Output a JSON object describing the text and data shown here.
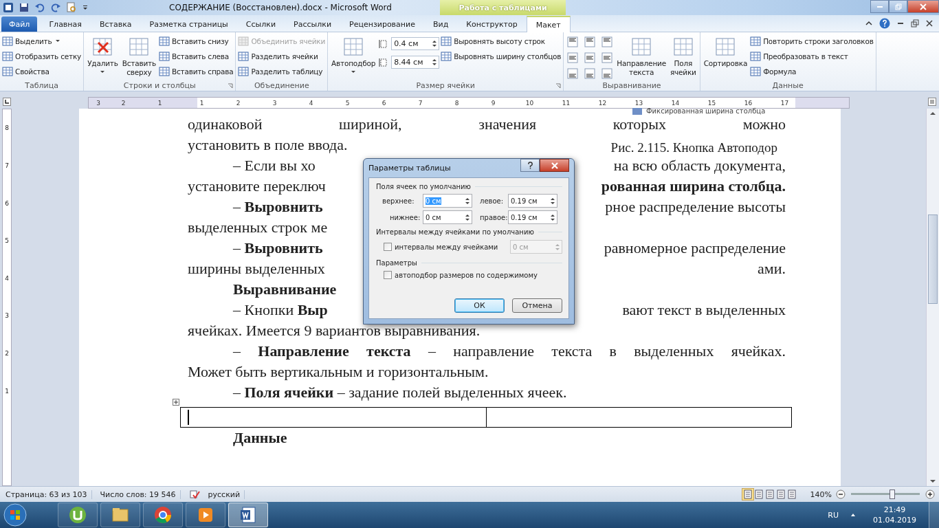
{
  "window": {
    "title": "СОДЕРЖАНИЕ (Восстановлен).docx - Microsoft Word",
    "context_group": "Работа с таблицами"
  },
  "tabs": [
    {
      "label": "Файл",
      "kind": "file",
      "selected": false
    },
    {
      "label": "Главная",
      "kind": "normal",
      "selected": false
    },
    {
      "label": "Вставка",
      "kind": "normal",
      "selected": false
    },
    {
      "label": "Разметка страницы",
      "kind": "normal",
      "selected": false
    },
    {
      "label": "Ссылки",
      "kind": "normal",
      "selected": false
    },
    {
      "label": "Рассылки",
      "kind": "normal",
      "selected": false
    },
    {
      "label": "Рецензирование",
      "kind": "normal",
      "selected": false
    },
    {
      "label": "Вид",
      "kind": "normal",
      "selected": false
    },
    {
      "label": "Конструктор",
      "kind": "context",
      "selected": false
    },
    {
      "label": "Макет",
      "kind": "context",
      "selected": true
    }
  ],
  "ribbon_groups": [
    {
      "label": "Таблица",
      "launcher": false,
      "columns": [
        {
          "kind": "stack",
          "items": [
            {
              "label": "Выделить",
              "dropdown": true,
              "disabled": false
            },
            {
              "label": "Отобразить сетку",
              "dropdown": false,
              "disabled": false
            },
            {
              "label": "Свойства",
              "dropdown": false,
              "disabled": false
            }
          ]
        }
      ]
    },
    {
      "label": "Строки и столбцы",
      "launcher": true,
      "columns": [
        {
          "kind": "large",
          "label": "Удалить",
          "dropdown": true
        },
        {
          "kind": "large",
          "label": "Вставить сверху",
          "dropdown": false
        },
        {
          "kind": "stack",
          "items": [
            {
              "label": "Вставить снизу",
              "dropdown": false,
              "disabled": false
            },
            {
              "label": "Вставить слева",
              "dropdown": false,
              "disabled": false
            },
            {
              "label": "Вставить справа",
              "dropdown": false,
              "disabled": false
            }
          ]
        }
      ]
    },
    {
      "label": "Объединение",
      "launcher": false,
      "columns": [
        {
          "kind": "stack",
          "items": [
            {
              "label": "Объединить ячейки",
              "dropdown": false,
              "disabled": true
            },
            {
              "label": "Разделить ячейки",
              "dropdown": false,
              "disabled": false
            },
            {
              "label": "Разделить таблицу",
              "dropdown": false,
              "disabled": false
            }
          ]
        }
      ]
    },
    {
      "label": "Размер ячейки",
      "launcher": true,
      "columns": [
        {
          "kind": "large",
          "label": "Автоподбор",
          "dropdown": true
        },
        {
          "kind": "spinners",
          "items": [
            {
              "value": "0.4 см"
            },
            {
              "value": "8.44 см"
            }
          ]
        },
        {
          "kind": "stack",
          "items": [
            {
              "label": "Выровнять высоту строк",
              "dropdown": false,
              "disabled": false
            },
            {
              "label": "Выровнять ширину столбцов",
              "dropdown": false,
              "disabled": false
            }
          ]
        }
      ]
    },
    {
      "label": "Выравнивание",
      "launcher": false,
      "columns": [
        {
          "kind": "align_grid"
        },
        {
          "kind": "large",
          "label": "Направление текста",
          "dropdown": false
        },
        {
          "kind": "large",
          "label": "Поля ячейки",
          "dropdown": false
        }
      ]
    },
    {
      "label": "Данные",
      "launcher": false,
      "columns": [
        {
          "kind": "large",
          "label": "Сортировка",
          "dropdown": false
        },
        {
          "kind": "stack",
          "items": [
            {
              "label": "Повторить строки заголовков",
              "dropdown": false,
              "disabled": false
            },
            {
              "label": "Преобразовать в текст",
              "dropdown": false,
              "disabled": false
            },
            {
              "label": "Формула",
              "dropdown": false,
              "disabled": false
            }
          ]
        }
      ]
    }
  ],
  "ruler": {
    "left_numbers": [
      "3",
      "2",
      "1"
    ],
    "numbers": [
      "1",
      "2",
      "3",
      "4",
      "5",
      "6",
      "7",
      "8",
      "9",
      "10",
      "11",
      "12",
      "13",
      "14",
      "15",
      "16",
      "17"
    ],
    "vertical_numbers": [
      "8",
      "7",
      "6",
      "5",
      "4",
      "3",
      "2",
      "1"
    ]
  },
  "document": {
    "figure_fragment": "Фиксированная ширина столбца",
    "lines": [
      {
        "left": "одинаковой шириной, значения которых можно",
        "indent": false,
        "justify": true
      },
      {
        "left": "установить в поле ввода.",
        "caption": "Рис. 2.115. Кнопка Автоподор",
        "indent": false,
        "justify": false
      },
      {
        "left": "– Если вы хо",
        "right": "на всю область документа,",
        "indent": true,
        "justify": false
      },
      {
        "left": "установите переключ",
        "right": "**рованная ширина столбца.**",
        "indent": false,
        "justify": false
      },
      {
        "left": "– **Выровнить**",
        "right": "рное распределение высоты",
        "indent": true,
        "justify": false
      },
      {
        "left": "выделенных строк ме",
        "indent": false,
        "justify": false
      },
      {
        "left": "– **Выровнить**",
        "right": "равномерное распределение",
        "indent": true,
        "justify": false
      },
      {
        "left": "ширины выделенных",
        "right": "ами.",
        "indent": false,
        "justify": false
      },
      {
        "left": "**Выравнивание**",
        "indent": true,
        "justify": false
      },
      {
        "left": "– Кнопки **Выр**",
        "right": "вают текст в выделенных",
        "indent": true,
        "justify": false
      },
      {
        "left": "ячейках. Имеется 9 вариантов выравнивания.",
        "indent": false,
        "justify": false
      },
      {
        "left": "– **Направление текста** – направление текста в выделенных ячейках.",
        "indent": true,
        "justify": true
      },
      {
        "left": "Может быть вертикальным и горизонтальным.",
        "indent": false,
        "justify": false
      },
      {
        "left": "– **Поля ячейки** – задание полей выделенных ячеек.",
        "indent": true,
        "justify": false
      }
    ],
    "after_table": "Данные"
  },
  "dialog": {
    "title": "Параметры таблицы",
    "margins": {
      "title": "Поля ячеек по умолчанию",
      "fields": [
        {
          "label": "верхнее:",
          "value": "0 см",
          "text_selected": true
        },
        {
          "label": "левое:",
          "value": "0.19 см",
          "text_selected": false
        },
        {
          "label": "нижнее:",
          "value": "0 см",
          "text_selected": false
        },
        {
          "label": "правое:",
          "value": "0.19 см",
          "text_selected": false
        }
      ]
    },
    "spacing": {
      "title": "Интервалы между ячейками по умолчанию",
      "checkbox": {
        "label": "интервалы между ячейками",
        "checked": false
      },
      "value": "0 см",
      "disabled": true
    },
    "options": {
      "title": "Параметры",
      "checkbox": {
        "label": "автоподбор размеров по содержимому",
        "checked": false
      }
    },
    "buttons": [
      {
        "label": "ОК",
        "default": true
      },
      {
        "label": "Отмена",
        "default": false
      }
    ]
  },
  "status_bar": {
    "page": "Страница: 63 из 103",
    "words": "Число слов: 19 546",
    "language": "русский",
    "zoom": "140%",
    "zoom_slider": {
      "level": 0.6
    }
  },
  "taskbar": {
    "apps": [
      {
        "kind": "utorrent",
        "selected": false
      },
      {
        "kind": "explorer",
        "selected": false
      },
      {
        "kind": "chrome",
        "selected": false
      },
      {
        "kind": "media",
        "selected": false
      },
      {
        "kind": "word",
        "selected": true
      }
    ],
    "language": "RU",
    "time": "21:49",
    "date": "01.04.2019"
  }
}
